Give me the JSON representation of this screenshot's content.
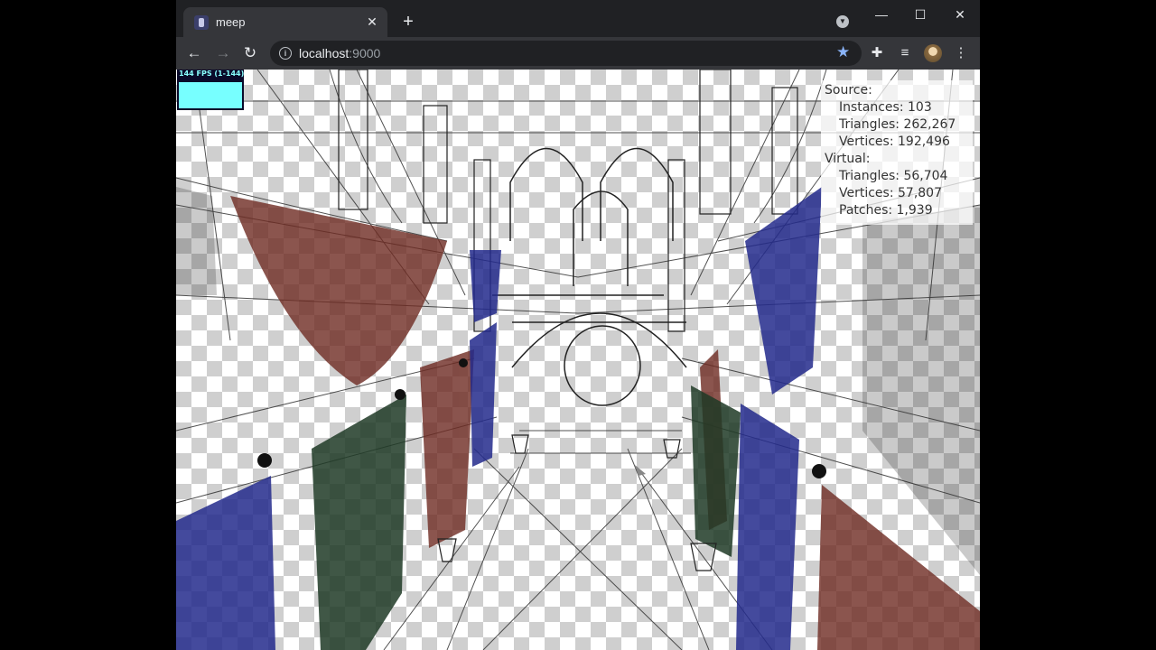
{
  "tab": {
    "title": "meep",
    "close_glyph": "✕",
    "new_glyph": "+"
  },
  "window_controls": {
    "minimize": "—",
    "maximize": "☐",
    "close": "✕"
  },
  "toolbar": {
    "back_glyph": "←",
    "forward_glyph": "→",
    "reload_glyph": "↻",
    "url_host": "localhost",
    "url_port": ":9000",
    "star_glyph": "★",
    "extensions_glyph": "✚",
    "media_glyph": "≡",
    "menu_glyph": "⋮"
  },
  "fps_meter": {
    "label": "144 FPS (1-144)"
  },
  "stats": {
    "source_label": "Source:",
    "instances": "Instances: 103",
    "source_triangles": "Triangles: 262,267",
    "source_vertices": "Vertices: 192,496",
    "virtual_label": "Virtual:",
    "virtual_triangles": "Triangles: 56,704",
    "virtual_vertices": "Vertices: 57,807",
    "patches": "Patches: 1,939"
  },
  "colors": {
    "drape_red": "#6e2a22",
    "drape_blue": "#232a8c",
    "drape_green": "#1f3a26",
    "wire": "#333333"
  }
}
